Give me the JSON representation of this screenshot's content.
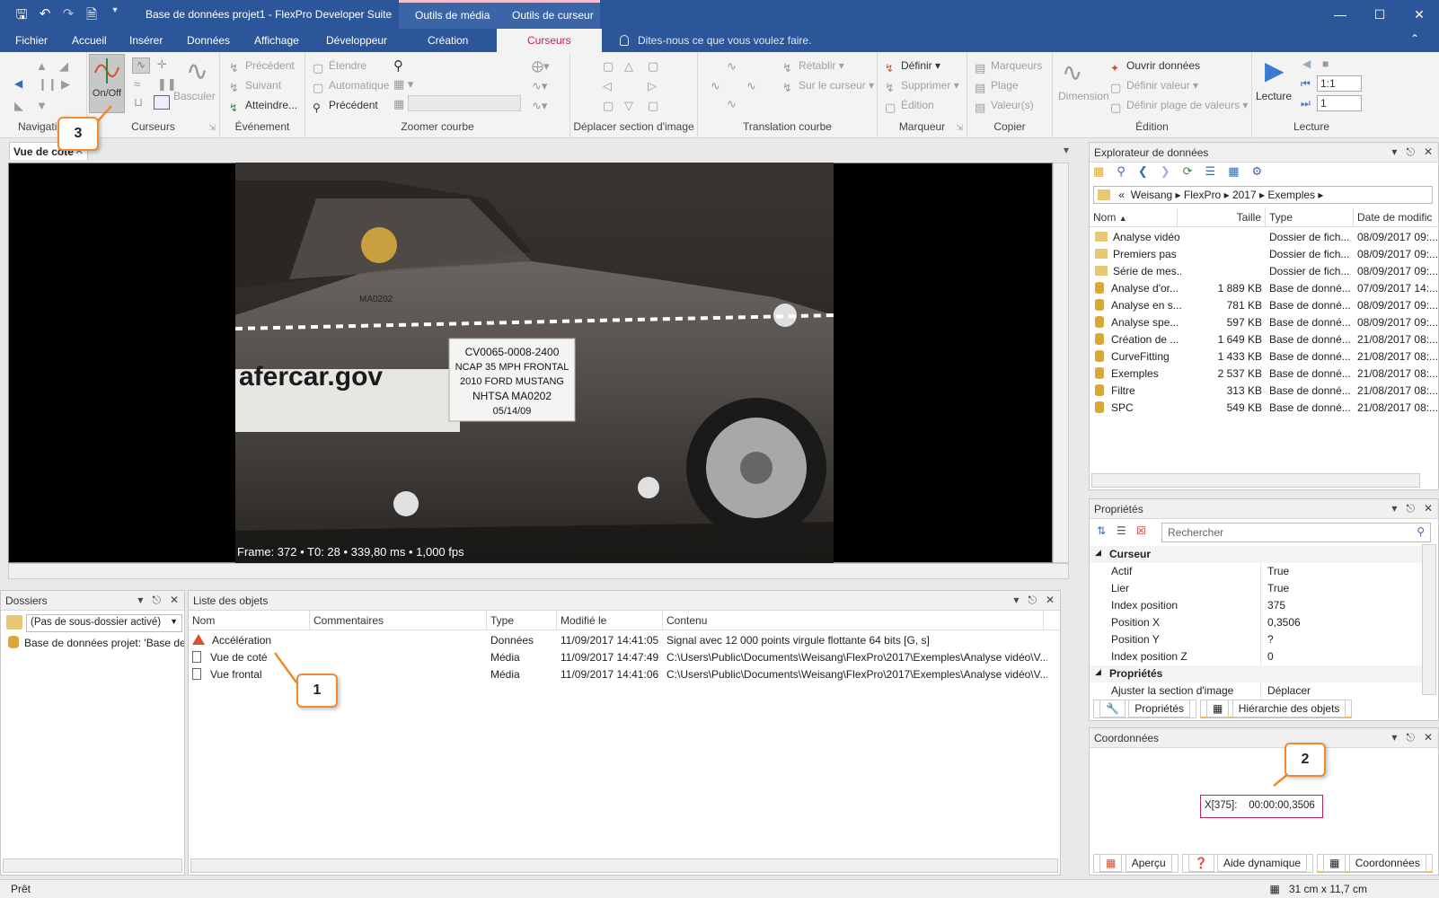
{
  "window": {
    "title": "Base de données projet1 - FlexPro Developer Suite",
    "context_groups": [
      "Outils de média",
      "Outils de curseur"
    ]
  },
  "tabs": [
    "Fichier",
    "Accueil",
    "Insérer",
    "Données",
    "Affichage",
    "Développeur",
    "Création",
    "Curseurs"
  ],
  "active_tab": "Curseurs",
  "tell_me": "Dites-nous ce que vous voulez faire.",
  "ribbon": {
    "groups": {
      "navigation": "Navigation",
      "curseurs": "Curseurs",
      "evenement": "Événement",
      "zoomer": "Zoomer courbe",
      "deplacer": "Déplacer section d'image",
      "translation": "Translation courbe",
      "marqueur": "Marqueur",
      "copier": "Copier",
      "edition": "Édition",
      "lecture": "Lecture"
    },
    "onoff": "On/Off",
    "basculer": "Basculer",
    "precedent_evt": "Précédent",
    "suivant": "Suivant",
    "atteindre": "Atteindre...",
    "etendre": "Étendre",
    "automatique": "Automatique",
    "precedent_zoom": "Précédent",
    "retablir": "Rétablir",
    "sur_le_curseur": "Sur le curseur",
    "definir": "Définir",
    "supprimer": "Supprimer",
    "edition_btn": "Édition",
    "marqueurs": "Marqueurs",
    "plage": "Plage",
    "valeurs": "Valeur(s)",
    "dimension": "Dimension",
    "ouvrir_donnees": "Ouvrir données",
    "definir_valeur": "Définir valeur",
    "definir_plage": "Définir plage de valeurs",
    "lecture_btn": "Lecture",
    "speed": "1:1",
    "step": "1"
  },
  "document_tab": "Vue de côté",
  "video": {
    "overlay": "Frame: 372 • T0: 28 • 339,80 ms • 1,000 fps",
    "label_ma": "MA0202",
    "placard": [
      "CV0065-0008-2400",
      "NCAP 35 MPH FRONTAL",
      "2010 FORD MUSTANG",
      "NHTSA MA0202",
      "05/14/09"
    ],
    "door_text": "afercar.gov"
  },
  "dossiers": {
    "title": "Dossiers",
    "combo": "(Pas de sous-dossier activé)",
    "db": "Base de données projet: 'Base de d"
  },
  "liste": {
    "title": "Liste des objets",
    "columns": [
      "Nom",
      "Commentaires",
      "Type",
      "Modifié le",
      "Contenu"
    ],
    "rows": [
      {
        "name": "Accélération",
        "comment": "",
        "type": "Données",
        "modified": "11/09/2017 14:41:05",
        "content": "Signal avec 12 000 points virgule flottante 64 bits [G, s]"
      },
      {
        "name": "Vue de coté",
        "comment": "",
        "type": "Média",
        "modified": "11/09/2017 14:47:49",
        "content": "C:\\Users\\Public\\Documents\\Weisang\\FlexPro\\2017\\Exemples\\Analyse vidéo\\V..."
      },
      {
        "name": "Vue frontal",
        "comment": "",
        "type": "Média",
        "modified": "11/09/2017 14:41:06",
        "content": "C:\\Users\\Public\\Documents\\Weisang\\FlexPro\\2017\\Exemples\\Analyse vidéo\\V..."
      }
    ]
  },
  "explorer": {
    "title": "Explorateur de données",
    "path": [
      "«",
      "Weisang",
      "FlexPro",
      "2017",
      "Exemples"
    ],
    "columns": [
      "Nom",
      "Taille",
      "Type",
      "Date de modific"
    ],
    "rows": [
      {
        "name": "Analyse vidéo",
        "size": "",
        "type": "Dossier de fich...",
        "date": "08/09/2017 09:...",
        "kind": "folder"
      },
      {
        "name": "Premiers pas",
        "size": "",
        "type": "Dossier de fich...",
        "date": "08/09/2017 09:...",
        "kind": "folder"
      },
      {
        "name": "Série de mes...",
        "size": "",
        "type": "Dossier de fich...",
        "date": "08/09/2017 09:...",
        "kind": "folder"
      },
      {
        "name": "Analyse d'or...",
        "size": "1 889 KB",
        "type": "Base de donné...",
        "date": "07/09/2017 14:...",
        "kind": "db"
      },
      {
        "name": "Analyse en s...",
        "size": "781 KB",
        "type": "Base de donné...",
        "date": "08/09/2017 09:...",
        "kind": "db"
      },
      {
        "name": "Analyse spe...",
        "size": "597 KB",
        "type": "Base de donné...",
        "date": "08/09/2017 09:...",
        "kind": "db"
      },
      {
        "name": "Création de ...",
        "size": "1 649 KB",
        "type": "Base de donné...",
        "date": "21/08/2017 08:...",
        "kind": "db"
      },
      {
        "name": "CurveFitting",
        "size": "1 433 KB",
        "type": "Base de donné...",
        "date": "21/08/2017 08:...",
        "kind": "db"
      },
      {
        "name": "Exemples",
        "size": "2 537 KB",
        "type": "Base de donné...",
        "date": "21/08/2017 08:...",
        "kind": "db"
      },
      {
        "name": "Filtre",
        "size": "313 KB",
        "type": "Base de donné...",
        "date": "21/08/2017 08:...",
        "kind": "db"
      },
      {
        "name": "SPC",
        "size": "549 KB",
        "type": "Base de donné...",
        "date": "21/08/2017 08:...",
        "kind": "db"
      }
    ]
  },
  "properties": {
    "title": "Propriétés",
    "search_placeholder": "Rechercher",
    "rows": [
      {
        "key": "Curseur",
        "value": "",
        "section": true
      },
      {
        "key": "Actif",
        "value": "True"
      },
      {
        "key": "Lier",
        "value": "True"
      },
      {
        "key": "Index position",
        "value": "375"
      },
      {
        "key": "Position X",
        "value": "0,3506"
      },
      {
        "key": "Position Y",
        "value": "?"
      },
      {
        "key": "Index position Z",
        "value": "0"
      },
      {
        "key": "Propriétés",
        "value": "",
        "section": true
      },
      {
        "key": "Ajuster la section d'image",
        "value": "Déplacer"
      }
    ],
    "tabs": [
      "Propriétés",
      "Hiérarchie des objets"
    ]
  },
  "coords": {
    "title": "Coordonnées",
    "label": "X[375]:",
    "value": "00:00:00,3506",
    "tabs": [
      "Aperçu",
      "Aide dynamique",
      "Coordonnées"
    ]
  },
  "callouts": [
    "1",
    "2",
    "3"
  ],
  "status": {
    "left": "Prêt",
    "dimension": "31 cm x 11,7 cm"
  }
}
